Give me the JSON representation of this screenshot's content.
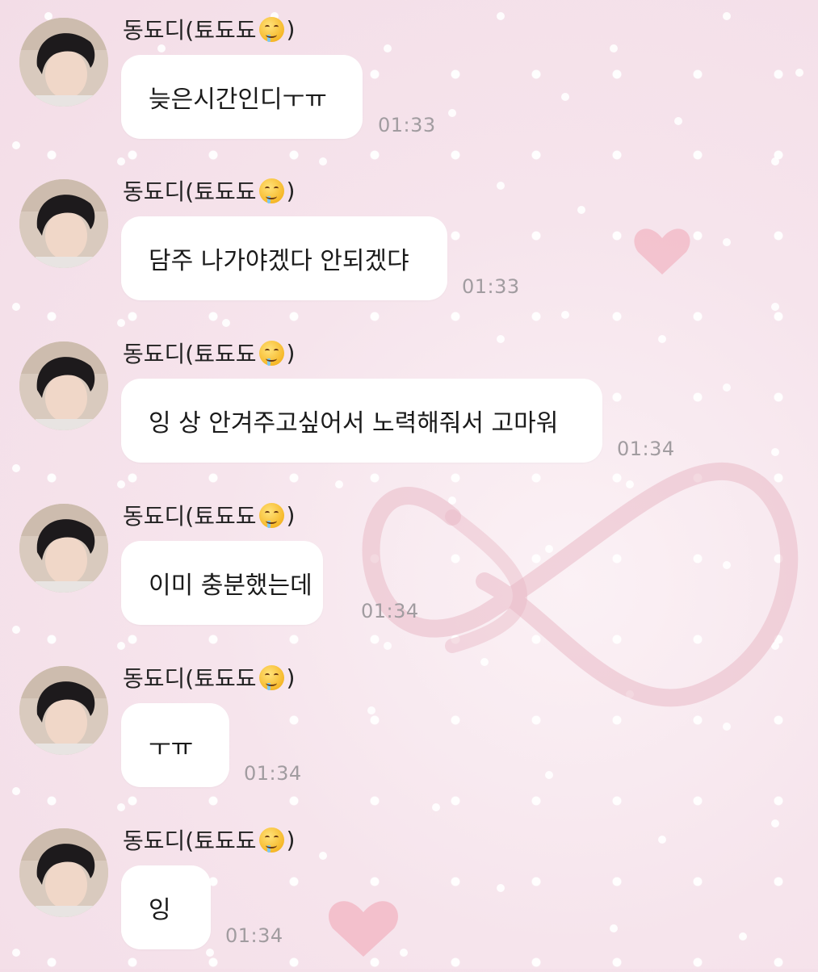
{
  "chat": {
    "messages": [
      {
        "sender": "동됴디(툐됴됴",
        "sender_suffix": ")",
        "text": "늦은시간인디ㅜㅠ",
        "time": "01:33"
      },
      {
        "sender": "동됴디(툐됴됴",
        "sender_suffix": ")",
        "text": "담주 나가야겠다 안되겠댜",
        "time": "01:33"
      },
      {
        "sender": "동됴디(툐됴됴",
        "sender_suffix": ")",
        "text": "잉 상 안겨주고싶어서 노력해줘서 고마워",
        "time": "01:34"
      },
      {
        "sender": "동됴디(툐됴됴",
        "sender_suffix": ")",
        "text": "이미 충분했는데",
        "time": "01:34"
      },
      {
        "sender": "동됴디(툐됴됴",
        "sender_suffix": ")",
        "text": "ㅜㅠ",
        "time": "01:34"
      },
      {
        "sender": "동됴디(툐됴됴",
        "sender_suffix": ")",
        "text": "잉",
        "time": "01:34"
      }
    ],
    "sender_emoji": "drooling-face-icon"
  },
  "colors": {
    "background": "#f8e9ef",
    "bubble": "#ffffff",
    "timestamp": "#a19ca0",
    "heart": "#f2b7c4",
    "ribbon": "#e9b9c6"
  }
}
